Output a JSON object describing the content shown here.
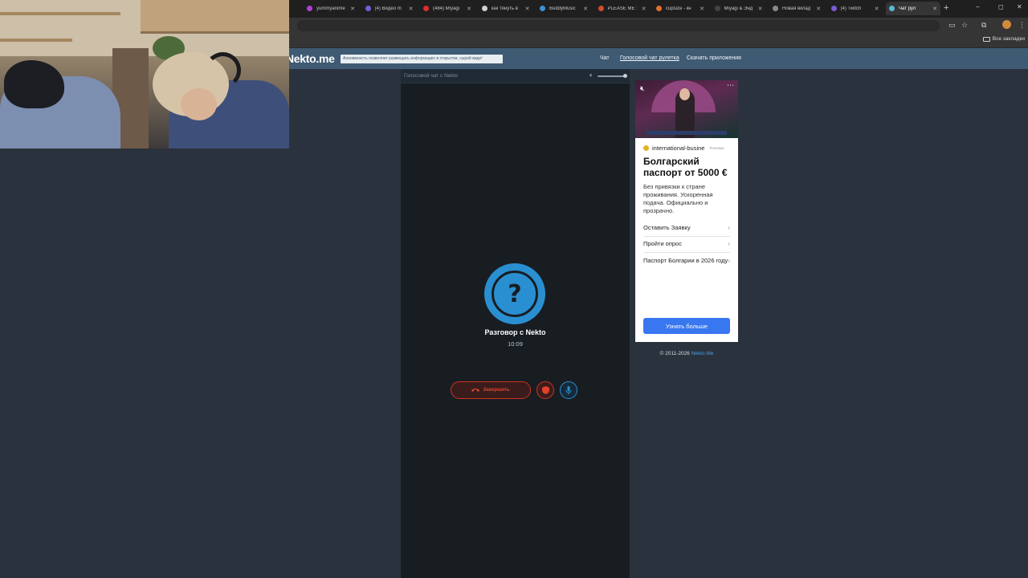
{
  "browser": {
    "tabs": [
      {
        "title": "yummyanime",
        "color": "#b13fd6"
      },
      {
        "title": "(4) Видео m",
        "color": "#7b5cd6"
      },
      {
        "title": "(484) Miyagi",
        "color": "#e02d2d"
      },
      {
        "title": "как тянуть в",
        "color": "#cfcfcf"
      },
      {
        "title": "BuddyMusic",
        "color": "#3d8fd6"
      },
      {
        "title": "PLEASE ME :",
        "color": "#d64a2d"
      },
      {
        "title": "cupsize - кн",
        "color": "#e0702d"
      },
      {
        "title": "Miyagi & Энд",
        "color": "#444"
      },
      {
        "title": "Новая вклад",
        "color": "#8a8a8a"
      },
      {
        "title": "(4) Twitch",
        "color": "#7b5cd6"
      },
      {
        "title": "Чат рул",
        "color": "#5bb7d8"
      }
    ],
    "new_tab": "+",
    "window_controls": [
      "–",
      "◻",
      "✕"
    ],
    "bookmarks_all": "Все закладки"
  },
  "site": {
    "logo": "Nekto.me",
    "notice": "Анонимность позволяет размещать информацию в открытом, сырой виде!",
    "nav": [
      "Чат",
      "Голосовой чат рулетка",
      "Скачать приложения"
    ]
  },
  "chat": {
    "panel_title": "Голосовой чат с Nekto",
    "peer_symbol": "?",
    "peer_title": "Разговор с Nekto",
    "timer": "10:09",
    "end_label": "Завершить",
    "volume_level": 1.0
  },
  "ad": {
    "source": "international-busine",
    "source_tag": "Реклама",
    "headline": "Болгарский паспорт от 5000 €",
    "description": "Без привязки к стране проживания. Ускоренная подача. Официально и прозрачно.",
    "links": [
      "Оставить Заявку",
      "Пройти опрос",
      "Паспорт Болгарии в 2026 году"
    ],
    "cta": "Узнать больше"
  },
  "footer": {
    "copyright": "© 2011-2026",
    "brand": "Nekto.Me"
  }
}
